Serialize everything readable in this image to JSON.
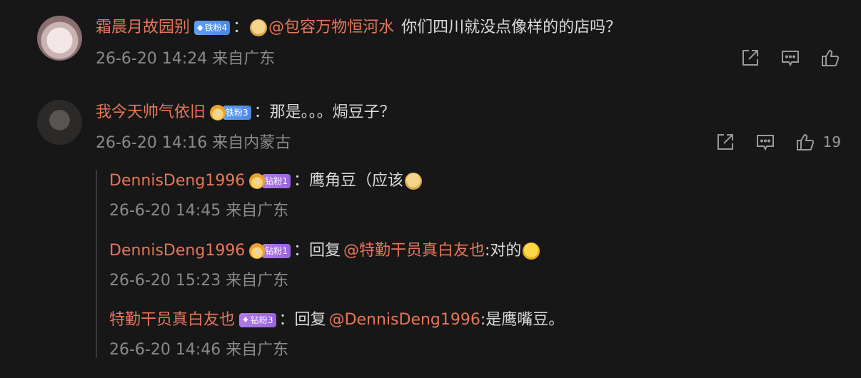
{
  "comments": [
    {
      "user": "霜晨月故园别",
      "badge": "铁粉4",
      "sep": "：",
      "mention": "@包容万物恒河水",
      "text": "你们四川就没点像样的的店吗？",
      "meta": "26-6-20 14:24 来自广东"
    },
    {
      "user": "我今天帅气依旧",
      "badge": "铁粉3",
      "sep": "：",
      "text": "那是。。。焗豆子？",
      "meta": "26-6-20 14:16 来自内蒙古",
      "likes": "19",
      "replies": [
        {
          "user": "DennisDeng1996",
          "badge": "钻粉1",
          "sep": "：",
          "text": "鹰角豆（应该",
          "meta": "26-6-20 14:45 来自广东"
        },
        {
          "user": "DennisDeng1996",
          "badge": "钻粉1",
          "sep": "：",
          "reply_prefix": "回复",
          "mention": "@特勤干员真白友也",
          "text": ":对的",
          "meta": "26-6-20 15:23 来自广东"
        },
        {
          "user": "特勤干员真白友也",
          "badge": "钻粉3",
          "sep": "：",
          "reply_prefix": "回复",
          "mention": "@DennisDeng1996",
          "text": ":是鹰嘴豆。",
          "meta": "26-6-20 14:46 来自广东"
        }
      ]
    }
  ],
  "icons": {
    "share": "share-icon",
    "comment": "comment-icon",
    "like": "thumbs-up-icon"
  },
  "colors": {
    "background": "#171717",
    "username": "#e8765a",
    "text": "#d9d9d9",
    "meta": "#8a8a8a"
  }
}
